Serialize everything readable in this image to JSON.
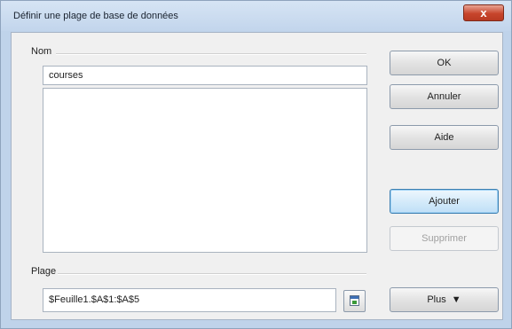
{
  "window": {
    "title": "Définir une plage de base de données",
    "close_glyph": "x"
  },
  "name_group": {
    "label": "Nom",
    "value": "courses",
    "list_items": []
  },
  "range_group": {
    "label": "Plage",
    "value": "$Feuille1.$A$1:$A$5",
    "shrink_icon": "shrink-dialog-icon"
  },
  "buttons": {
    "ok": "OK",
    "cancel": "Annuler",
    "help": "Aide",
    "add": "Ajouter",
    "delete": "Supprimer",
    "more": "Plus",
    "more_glyph": "▼"
  },
  "colors": {
    "default_button_border": "#3c7fb1",
    "close_button": "#c7452c"
  }
}
